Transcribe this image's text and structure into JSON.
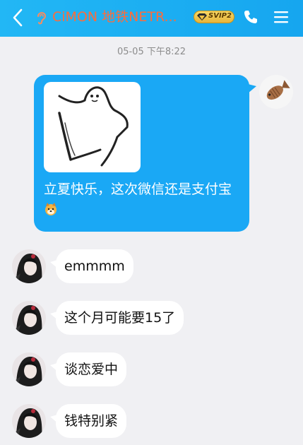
{
  "header": {
    "title": "CiMON 地铁NETR...",
    "badge_label": "SVIP2",
    "back_icon": "chevron-left-icon",
    "voice_icon": "ear-icon",
    "phone_icon": "phone-icon",
    "menu_icon": "hamburger-menu-icon"
  },
  "timestamp": "05-05 下午8:22",
  "colors": {
    "header_bg": "#1aa8f5",
    "title_color": "#ff6c3a",
    "outgoing_bubble": "#1aa8f5",
    "incoming_bubble": "#ffffff",
    "background": "#f0f0f3"
  },
  "outgoing_message": {
    "sticker_icon": "ghost-sticker-icon",
    "text": "立夏快乐，这次微信还是支付宝",
    "emoji_icon": "dog-face-emoji-icon"
  },
  "incoming_messages": [
    {
      "text": "emmmm"
    },
    {
      "text": "这个月可能要15了"
    },
    {
      "text": "谈恋爱中"
    },
    {
      "text": "钱特别紧"
    }
  ]
}
